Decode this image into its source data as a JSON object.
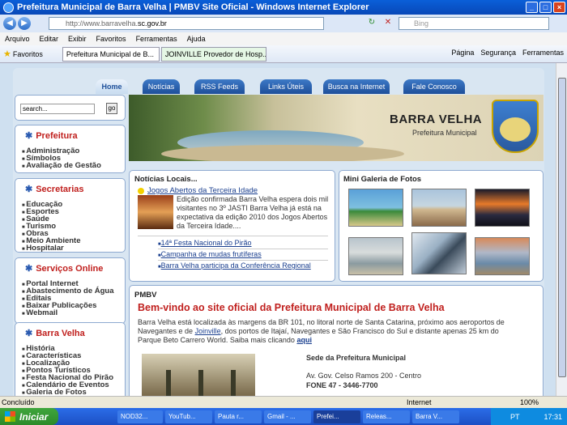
{
  "browser": {
    "title": "Prefeitura Municipal de Barra Velha | PMBV Site Oficial - Windows Internet Explorer",
    "url_prefix": "http://www.barravelha.",
    "url_domain": "sc.gov.br",
    "search_placeholder": "Bing",
    "menu": [
      "Arquivo",
      "Editar",
      "Exibir",
      "Favoritos",
      "Ferramentas",
      "Ajuda"
    ],
    "favorites_label": "Favoritos",
    "tabs": [
      "Prefeitura Municipal de B...",
      "JOINVILLE Provedor de Hosp..."
    ],
    "tools": [
      "Página",
      "Segurança",
      "Ferramentas"
    ]
  },
  "site": {
    "nav": [
      "Home",
      "Notícias",
      "RSS Feeds",
      "Links Úteis",
      "Busca na Internet",
      "Fale Conosco"
    ],
    "search_placeholder": "search...",
    "search_button": "go",
    "sections": [
      {
        "title": "Prefeitura",
        "links": [
          "Administração",
          "Símbolos",
          "Avaliação de Gestão"
        ]
      },
      {
        "title": "Secretarias",
        "links": [
          "Educação",
          "Esportes",
          "Saúde",
          "Turismo",
          "Obras",
          "Meio Ambiente",
          "Hospitalar"
        ]
      },
      {
        "title": "Serviços Online",
        "links": [
          "Portal Internet",
          "Abastecimento de Água",
          "Editais",
          "Baixar Publicações",
          "Webmail"
        ]
      },
      {
        "title": "Barra Velha",
        "links": [
          "História",
          "Características",
          "Localização",
          "Pontos Turísticos",
          "Festa Nacional do Pirão",
          "Calendário de Eventos",
          "Galeria de Fotos"
        ]
      }
    ],
    "banner": {
      "title": "BARRA VELHA",
      "subtitle": "Prefeitura Municipal"
    },
    "news": {
      "title": "Notícias Locais...",
      "headline": "Jogos Abertos da Terceira Idade",
      "text": "Edição confirmada Barra Velha espera dois mil visitantes no 3º JASTI    Barra Velha já está na expectativa da edição 2010 dos Jogos Abertos da Terceira Idade....",
      "items": [
        "14ª Festa Nacional do Pirão",
        "Campanha de mudas frutíferas",
        "Barra Velha participa da Conferência Regional"
      ]
    },
    "gallery": {
      "title": "Mini Galeria de Fotos"
    },
    "welcome": {
      "label": "PMBV",
      "title": "Bem-vindo ao site oficial da Prefeitura Municipal de Barra Velha",
      "text_a": "Barra Velha está localizada às margens da BR 101, no litoral norte de Santa Catarina, próximo aos aeroportos de Navegantes e de ",
      "text_link": "Joinville",
      "text_b": ", dos portos de Itajaí, Navegantes e São Francisco do Sul e distante apenas 25 km do Parque Beto Carrero World. Saiba mais clicando ",
      "more_link": "aqui",
      "sede_title": "Sede da Prefeitura Municipal",
      "sede_address": "Av. Gov. Celso Ramos 200 - Centro",
      "sede_phone": "FONE 47 - 3446-7700"
    }
  },
  "statusbar": {
    "text": "Concluído",
    "zone": "Internet",
    "zoom": "100%"
  },
  "taskbar": {
    "start": "Iniciar",
    "items": [
      "NOD32...",
      "YouTub...",
      "Pauta r...",
      "Gmail - ...",
      "Prefei...",
      "Releas...",
      "Barra V..."
    ],
    "lang": "PT",
    "clock": "17:31"
  }
}
